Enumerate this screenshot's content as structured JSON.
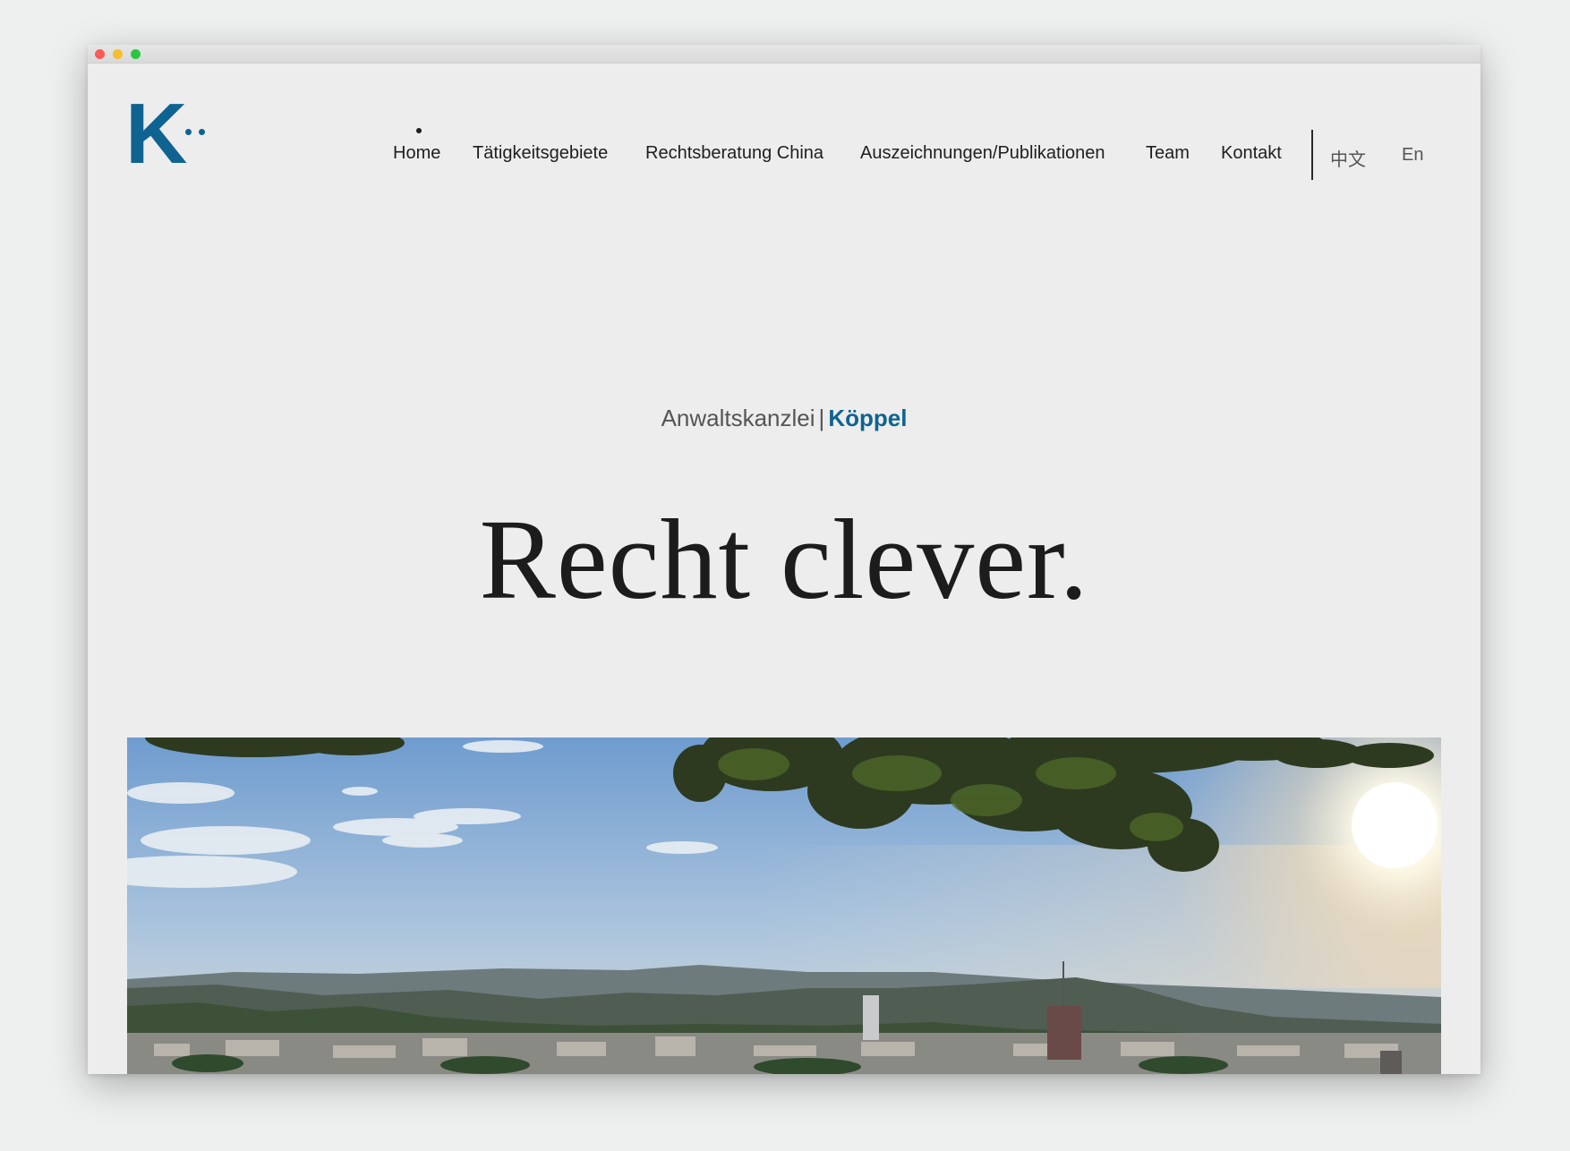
{
  "logo": {
    "letter": "K"
  },
  "nav": {
    "items": [
      {
        "label": "Home"
      },
      {
        "label": "Tätigkeitsgebiete"
      },
      {
        "label": "Rechtsberatung China"
      },
      {
        "label": "Auszeichnungen/Publikationen"
      },
      {
        "label": "Team"
      },
      {
        "label": "Kontakt"
      }
    ],
    "languages": [
      {
        "label": "中文"
      },
      {
        "label": "En"
      }
    ]
  },
  "hero": {
    "subtitle_prefix": "Anwaltskanzlei",
    "subtitle_separator": "|",
    "subtitle_brand": "Köppel",
    "headline": "Recht clever."
  },
  "colors": {
    "brand": "#0f6390",
    "text": "#1e1e1e",
    "background": "#ededed"
  }
}
